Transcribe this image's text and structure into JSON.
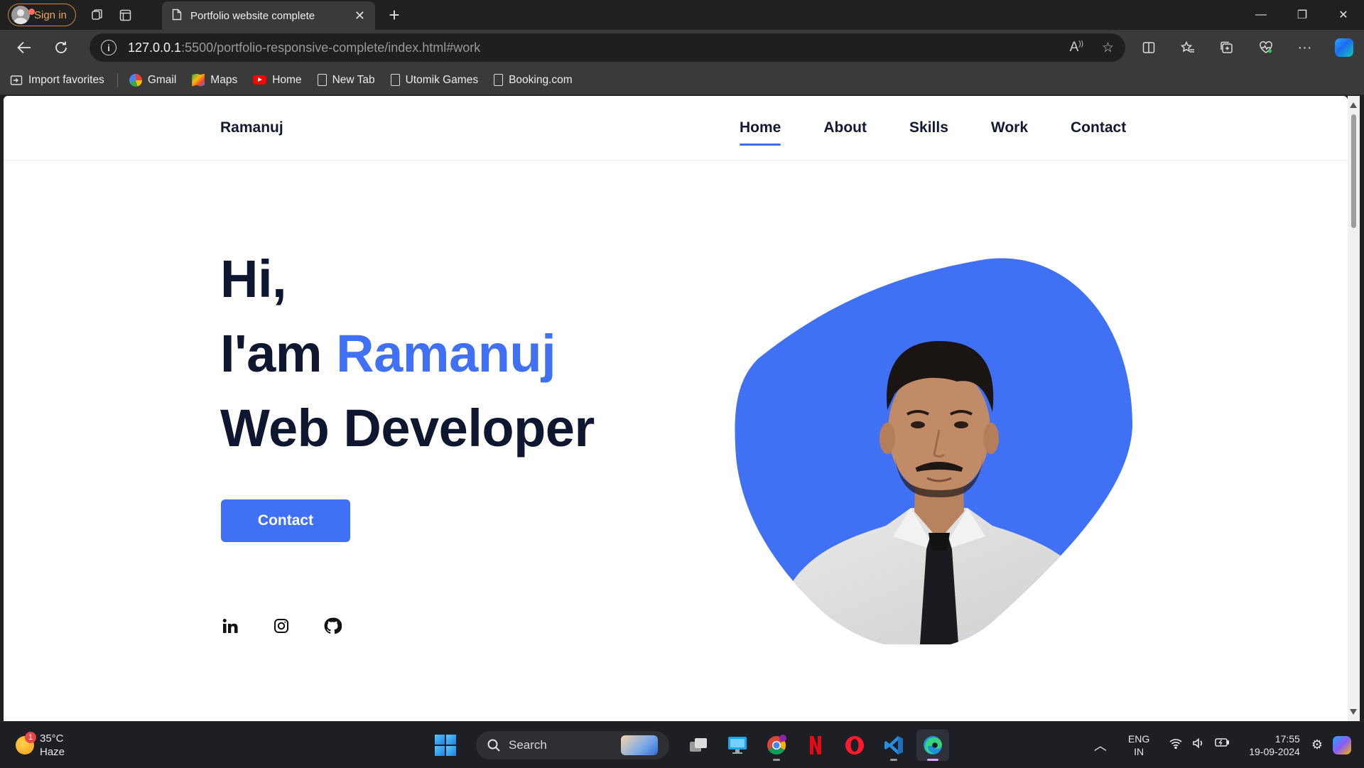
{
  "browser": {
    "signin_label": "Sign in",
    "tab_title": "Portfolio website complete",
    "url_host": "127.0.0.1",
    "url_path": ":5500/portfolio-responsive-complete/index.html#work",
    "bookmarks": [
      {
        "label": "Import favorites",
        "icon": "import-icon"
      },
      {
        "label": "Gmail",
        "icon": "google-icon"
      },
      {
        "label": "Maps",
        "icon": "maps-icon"
      },
      {
        "label": "Home",
        "icon": "youtube-icon"
      },
      {
        "label": "New Tab",
        "icon": "page-icon"
      },
      {
        "label": "Utomik Games",
        "icon": "page-icon"
      },
      {
        "label": "Booking.com",
        "icon": "page-icon"
      }
    ]
  },
  "site": {
    "logo": "Ramanuj",
    "nav": [
      "Home",
      "About",
      "Skills",
      "Work",
      "Contact"
    ],
    "active_nav": "Home",
    "hero": {
      "greeting": "Hi,",
      "intro": "I'am ",
      "name": "Ramanuj",
      "role": "Web Developer",
      "cta": "Contact"
    },
    "socials": [
      "linkedin-icon",
      "instagram-icon",
      "github-icon"
    ],
    "colors": {
      "accent": "#4070f4",
      "text": "#0f1730"
    }
  },
  "taskbar": {
    "weather_temp": "35°C",
    "weather_desc": "Haze",
    "weather_badge": "1",
    "search_label": "Search",
    "lang_top": "ENG",
    "lang_bottom": "IN",
    "time": "17:55",
    "date": "19-09-2024"
  }
}
